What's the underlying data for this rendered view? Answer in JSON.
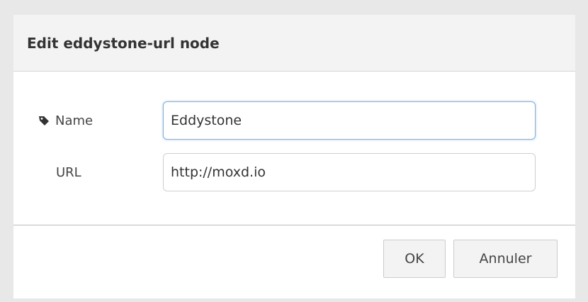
{
  "dialog": {
    "title": "Edit eddystone-url node"
  },
  "form": {
    "name": {
      "label": "Name",
      "value": "Eddystone",
      "icon": "tag-icon"
    },
    "url": {
      "label": "URL",
      "value": "http://moxd.io"
    }
  },
  "buttons": {
    "ok_label": "OK",
    "cancel_label": "Annuler"
  }
}
